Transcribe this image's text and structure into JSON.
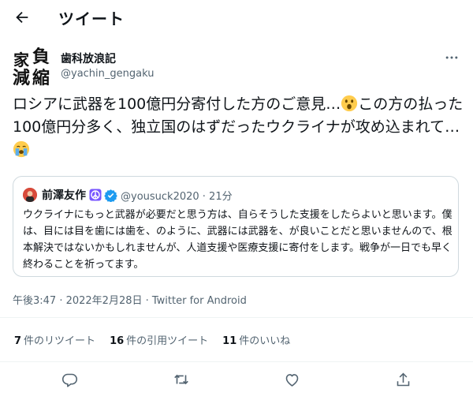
{
  "header": {
    "title": "ツイート",
    "back_icon": "arrow-left-icon"
  },
  "author": {
    "display_name": "歯科放浪記",
    "handle": "@yachin_gengaku",
    "avatar_glyphs": [
      "負",
      "家",
      "減",
      "縮"
    ]
  },
  "tweet": {
    "text_part1": "ロシアに武器を100億円分寄付した方のご意見…",
    "text_part2": "この方の払った100億円分多く、独立国のはずだったウクライナが攻め込まれて…",
    "emoji1": "astonished-face-emoji",
    "emoji2": "crying-face-emoji"
  },
  "quote": {
    "name": "前澤友作",
    "peace_icon": "peace-symbol-icon",
    "verified_icon": "verified-badge-icon",
    "handle_time": "@yousuck2020 · 21分",
    "text": "ウクライナにもっと武器が必要だと思う方は、自らそうした支援をしたらよいと思います。僕は、目には目を歯には歯を、のように、武器には武器を、が良いことだと思いませんので、根本解決ではないかもしれませんが、人道支援や医療支援に寄付をします。戦争が一日でも早く終わることを祈ってます。"
  },
  "meta": {
    "timestamp": "午後3:47 · 2022年2月28日 · Twitter for Android"
  },
  "stats": {
    "retweets_count": "7",
    "retweets_label": "件のリツイート",
    "quotes_count": "16",
    "quotes_label": "件の引用ツイート",
    "likes_count": "11",
    "likes_label": "件のいいね"
  },
  "actions": [
    "reply-icon",
    "retweet-icon",
    "like-icon",
    "share-icon"
  ],
  "colors": {
    "text": "#0f1419",
    "secondary": "#536471",
    "border": "#cfd9de",
    "divider": "#eff3f4",
    "verified": "#1d9bf0",
    "peace": "#7856ff"
  }
}
